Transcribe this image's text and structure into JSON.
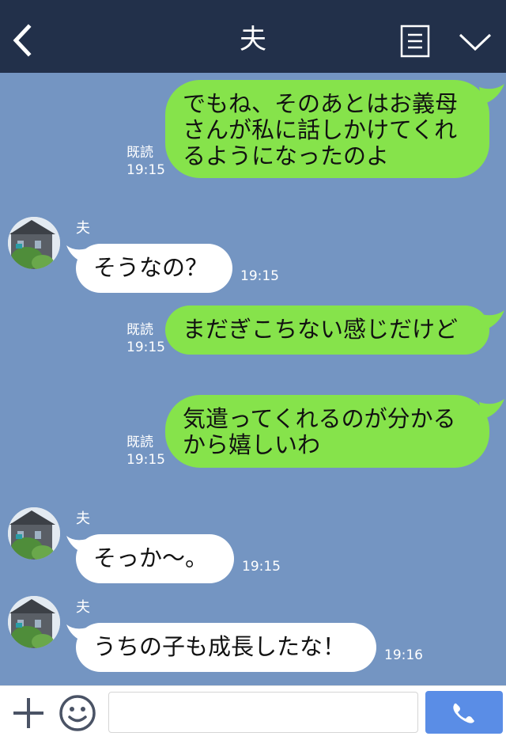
{
  "header": {
    "title": "夫"
  },
  "colors": {
    "header_bg": "#22304a",
    "chat_bg": "#7495c2",
    "outgoing_bubble": "#86e34b",
    "incoming_bubble": "#ffffff",
    "call_button": "#5a8de6"
  },
  "icons": {
    "back": "chevron-left-icon",
    "menu": "list-icon",
    "collapse": "chevron-down-icon",
    "add": "plus-icon",
    "emoji": "smiley-icon",
    "call": "phone-icon"
  },
  "messages": [
    {
      "direction": "out",
      "text": "でもね、そのあとはお義母\nさんが私に話しかけてくれ\nるようになったのよ",
      "read": "既読",
      "time": "19:15"
    },
    {
      "direction": "in",
      "sender": "夫",
      "text": "そうなの？",
      "time": "19:15"
    },
    {
      "direction": "out",
      "text": "まだぎこちない感じだけど",
      "read": "既読",
      "time": "19:15"
    },
    {
      "direction": "out",
      "text": "気遣ってくれるのが分かる\nから嬉しいわ",
      "read": "既読",
      "time": "19:15"
    },
    {
      "direction": "in",
      "sender": "夫",
      "text": "そっか〜。",
      "time": "19:15"
    },
    {
      "direction": "in",
      "sender": "夫",
      "text": "うちの子も成長したな！",
      "time": "19:16"
    }
  ],
  "input": {
    "value": "",
    "placeholder": ""
  }
}
